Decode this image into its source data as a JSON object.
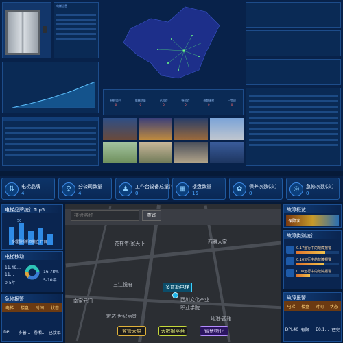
{
  "top": {
    "elevator_info_title": "电梯信息",
    "elevator_stats": [
      "待检项目",
      "电梯总量",
      "已检验",
      "待检验",
      "逾期未检",
      "已完成"
    ],
    "elevator_stat_values": [
      "0",
      "0",
      "0",
      "0",
      "0",
      "0"
    ],
    "photos_count": 10
  },
  "stats": [
    {
      "icon": "elevator-icon",
      "glyph": "⇅",
      "label": "电梯品牌",
      "value": "4"
    },
    {
      "icon": "company-icon",
      "glyph": "♀",
      "label": "分公司数量",
      "value": "4"
    },
    {
      "icon": "device-icon",
      "glyph": "♟",
      "label": "工作台设备总量(台)",
      "value": "0"
    },
    {
      "icon": "building-icon",
      "glyph": "▦",
      "label": "楼盘数量",
      "value": "15"
    },
    {
      "icon": "shield-icon",
      "glyph": "✿",
      "label": "保养次数(次)",
      "value": "0"
    },
    {
      "icon": "alarm-icon",
      "glyph": "◎",
      "label": "急修次数(次)",
      "value": "0"
    }
  ],
  "left": {
    "brand_title": "电梯品牌统计Top5",
    "brand_value": "50",
    "brand_axis": "多理翻折新西撒立 厂目",
    "cost_title": "电梯移动",
    "cost_left": [
      "11.49…",
      "11...",
      "0-5年"
    ],
    "cost_right": [
      "16.78%",
      "5-10年"
    ],
    "urgent_title": "急修报警",
    "urgent_headers": [
      "电梯",
      "楼盘",
      "时间",
      "状态"
    ],
    "urgent_row": [
      "DPL...",
      "多普...",
      "杨湘...",
      "已接单"
    ]
  },
  "map": {
    "search_label": "楼盘名称",
    "search_button": "查询",
    "labels": [
      "花样年·家天下",
      "西雅人家",
      "三江悦府",
      "多普勒电梯",
      "西川文化产业",
      "职业学院",
      "宏达·世纪丽景",
      "地港·西雅",
      "南家元门"
    ],
    "marker_label": "多普勒电梯",
    "bottom_buttons": [
      "监管大屏",
      "大数据平台",
      "智慧物业"
    ]
  },
  "right": {
    "fault_title": "故障概览",
    "fault_row": "保障次",
    "fault_type_title": "故障类别统计",
    "fault_types": [
      {
        "label": "0.17运行中的故障报警",
        "pct": 17
      },
      {
        "label": "0.16运行中的故障报警",
        "pct": 16
      },
      {
        "label": "0.08运行中的故障报警",
        "pct": 8
      }
    ],
    "fault_warn_title": "故障报警",
    "fault_warn_headers": [
      "电梯",
      "楼盘",
      "时间",
      "状态"
    ],
    "fault_warn_row": [
      "DPL40",
      "有限…",
      "E0.1…",
      "已完"
    ]
  }
}
